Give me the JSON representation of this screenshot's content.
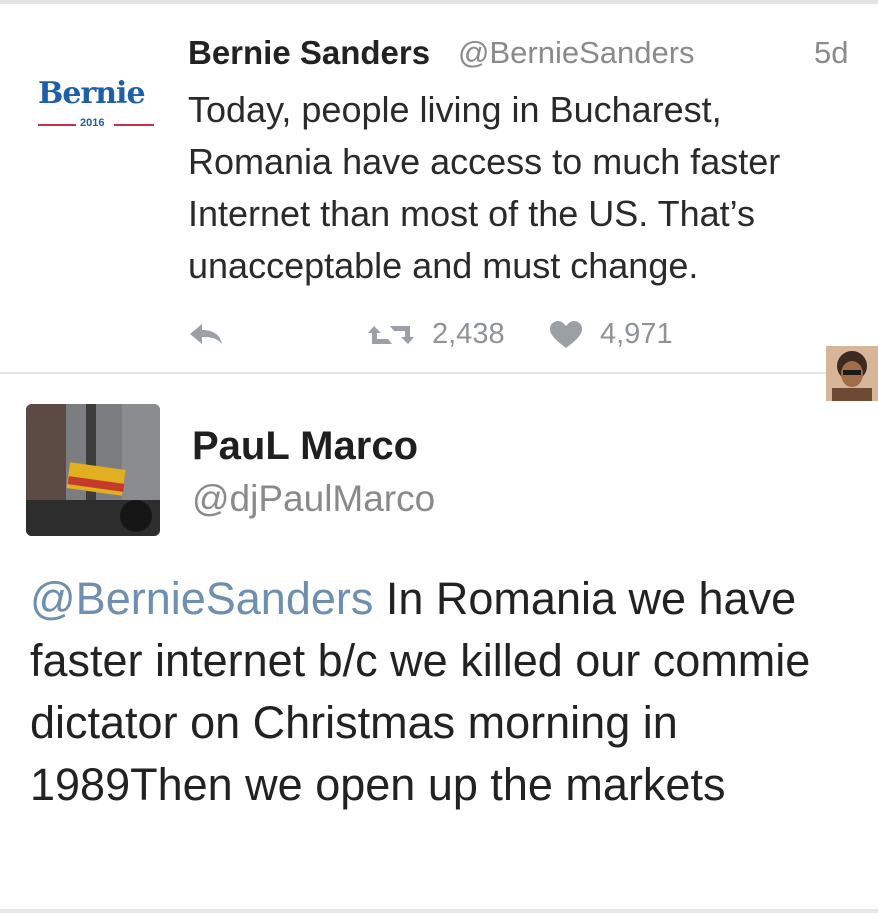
{
  "tweet1": {
    "logo_text": "Bernie",
    "logo_year": "2016",
    "name": "Bernie Sanders",
    "handle": "@BernieSanders",
    "time": "5d",
    "text": "Today, people living in Bucharest, Romania have access to much faster Internet than most of the US. That’s unacceptable and must change.",
    "retweets": "2,438",
    "likes": "4,971",
    "icons": [
      "reply-icon",
      "retweet-icon",
      "heart-icon"
    ]
  },
  "tweet2": {
    "name": "PauL Marco",
    "handle": "@djPaulMarco",
    "mention": "@BernieSanders",
    "text": " In Romania we have faster internet b/c we killed our commie dictator on Christmas morning in 1989Then we open up the markets"
  },
  "colors": {
    "mention": "#6f8fb0",
    "meta_gray": "#8a8a8a",
    "logo_blue": "#1f5fa8",
    "logo_red": "#c6304a"
  }
}
